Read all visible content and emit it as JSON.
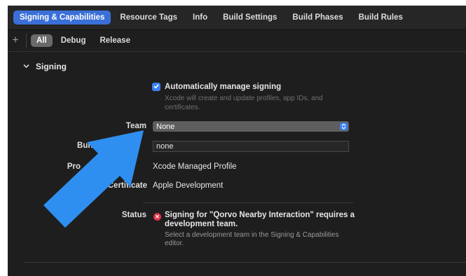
{
  "tabs": [
    {
      "label": "Signing & Capabilities",
      "active": true
    },
    {
      "label": "Resource Tags"
    },
    {
      "label": "Info"
    },
    {
      "label": "Build Settings"
    },
    {
      "label": "Build Phases"
    },
    {
      "label": "Build Rules"
    }
  ],
  "filter": {
    "add_symbol": "+",
    "options": [
      "All",
      "Debug",
      "Release"
    ],
    "selected": "All"
  },
  "signing": {
    "section_title": "Signing",
    "auto_manage_label": "Automatically manage signing",
    "auto_manage_checked": true,
    "auto_manage_hint": "Xcode will create and update profiles, app IDs, and certificates.",
    "team_label": "Team",
    "team_value": "None",
    "bundle_label": "Bundle",
    "bundle_value": "none",
    "profile_label": "Pro",
    "profile_value": "Xcode Managed Profile",
    "certificate_label": "Certificate",
    "certificate_value": "Apple Development",
    "status_label": "Status",
    "status_message": "Signing for \"Qorvo Nearby Interaction\" requires a development team.",
    "status_hint": "Select a development team in the Signing & Capabilities editor."
  },
  "colors": {
    "accent": "#3b82f6",
    "annotation_arrow": "#2f8ff0",
    "error": "#e0324a"
  },
  "icons": {
    "disclosure": "chevron-down-icon",
    "checkbox": "checkmark-icon",
    "stepper": "up-down-chevron-icon",
    "error": "error-x-icon"
  }
}
